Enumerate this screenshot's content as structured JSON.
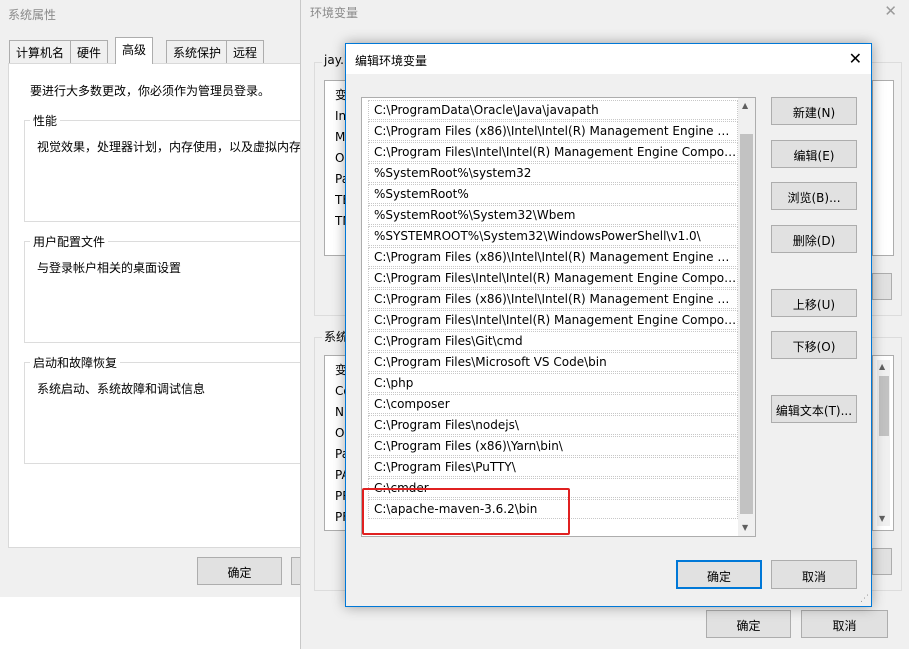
{
  "system_properties": {
    "title": "系统属性",
    "tabs": [
      "计算机名",
      "硬件",
      "高级",
      "系统保护",
      "远程"
    ],
    "active_tab": 2,
    "admin_note": "要进行大多数更改，你必须作为管理员登录。",
    "performance": {
      "title": "性能",
      "description": "视觉效果，处理器计划，内存使用，以及虚拟内存"
    },
    "user_profiles": {
      "title": "用户配置文件",
      "description": "与登录帐户相关的桌面设置"
    },
    "startup_recovery": {
      "title": "启动和故障恢复",
      "description": "系统启动、系统故障和调试信息"
    },
    "ok_label": "确定"
  },
  "env_vars": {
    "title": "环境变量",
    "close_glyph": "✕",
    "user_section_label": "jay.h",
    "user_list_peek": [
      "变",
      "In",
      "M",
      "O",
      "Pa",
      "TE",
      "TM"
    ],
    "system_section_label": "系统",
    "system_list_peek": [
      "变",
      "Co",
      "N",
      "O",
      "Pa",
      "PA",
      "PR",
      "PF"
    ],
    "ok_label": "确定",
    "cancel_label": "取消"
  },
  "edit_dialog": {
    "title": "编辑环境变量",
    "close_glyph": "✕",
    "entries": [
      "C:\\ProgramData\\Oracle\\Java\\javapath",
      "C:\\Program Files (x86)\\Intel\\Intel(R) Management Engine Co...",
      "C:\\Program Files\\Intel\\Intel(R) Management Engine Compon...",
      "%SystemRoot%\\system32",
      "%SystemRoot%",
      "%SystemRoot%\\System32\\Wbem",
      "%SYSTEMROOT%\\System32\\WindowsPowerShell\\v1.0\\",
      "C:\\Program Files (x86)\\Intel\\Intel(R) Management Engine Co...",
      "C:\\Program Files\\Intel\\Intel(R) Management Engine Compon...",
      "C:\\Program Files (x86)\\Intel\\Intel(R) Management Engine Co...",
      "C:\\Program Files\\Intel\\Intel(R) Management Engine Compon...",
      "C:\\Program Files\\Git\\cmd",
      "C:\\Program Files\\Microsoft VS Code\\bin",
      "C:\\php",
      "C:\\composer",
      "C:\\Program Files\\nodejs\\",
      "C:\\Program Files (x86)\\Yarn\\bin\\",
      "C:\\Program Files\\PuTTY\\",
      "C:\\cmder",
      "C:\\apache-maven-3.6.2\\bin"
    ],
    "buttons": {
      "new": "新建(N)",
      "edit": "编辑(E)",
      "browse": "浏览(B)...",
      "delete": "删除(D)",
      "move_up": "上移(U)",
      "move_down": "下移(O)",
      "edit_text": "编辑文本(T)...",
      "ok": "确定",
      "cancel": "取消"
    },
    "highlight_color": "#e02020",
    "accent_color": "#0078d7"
  }
}
